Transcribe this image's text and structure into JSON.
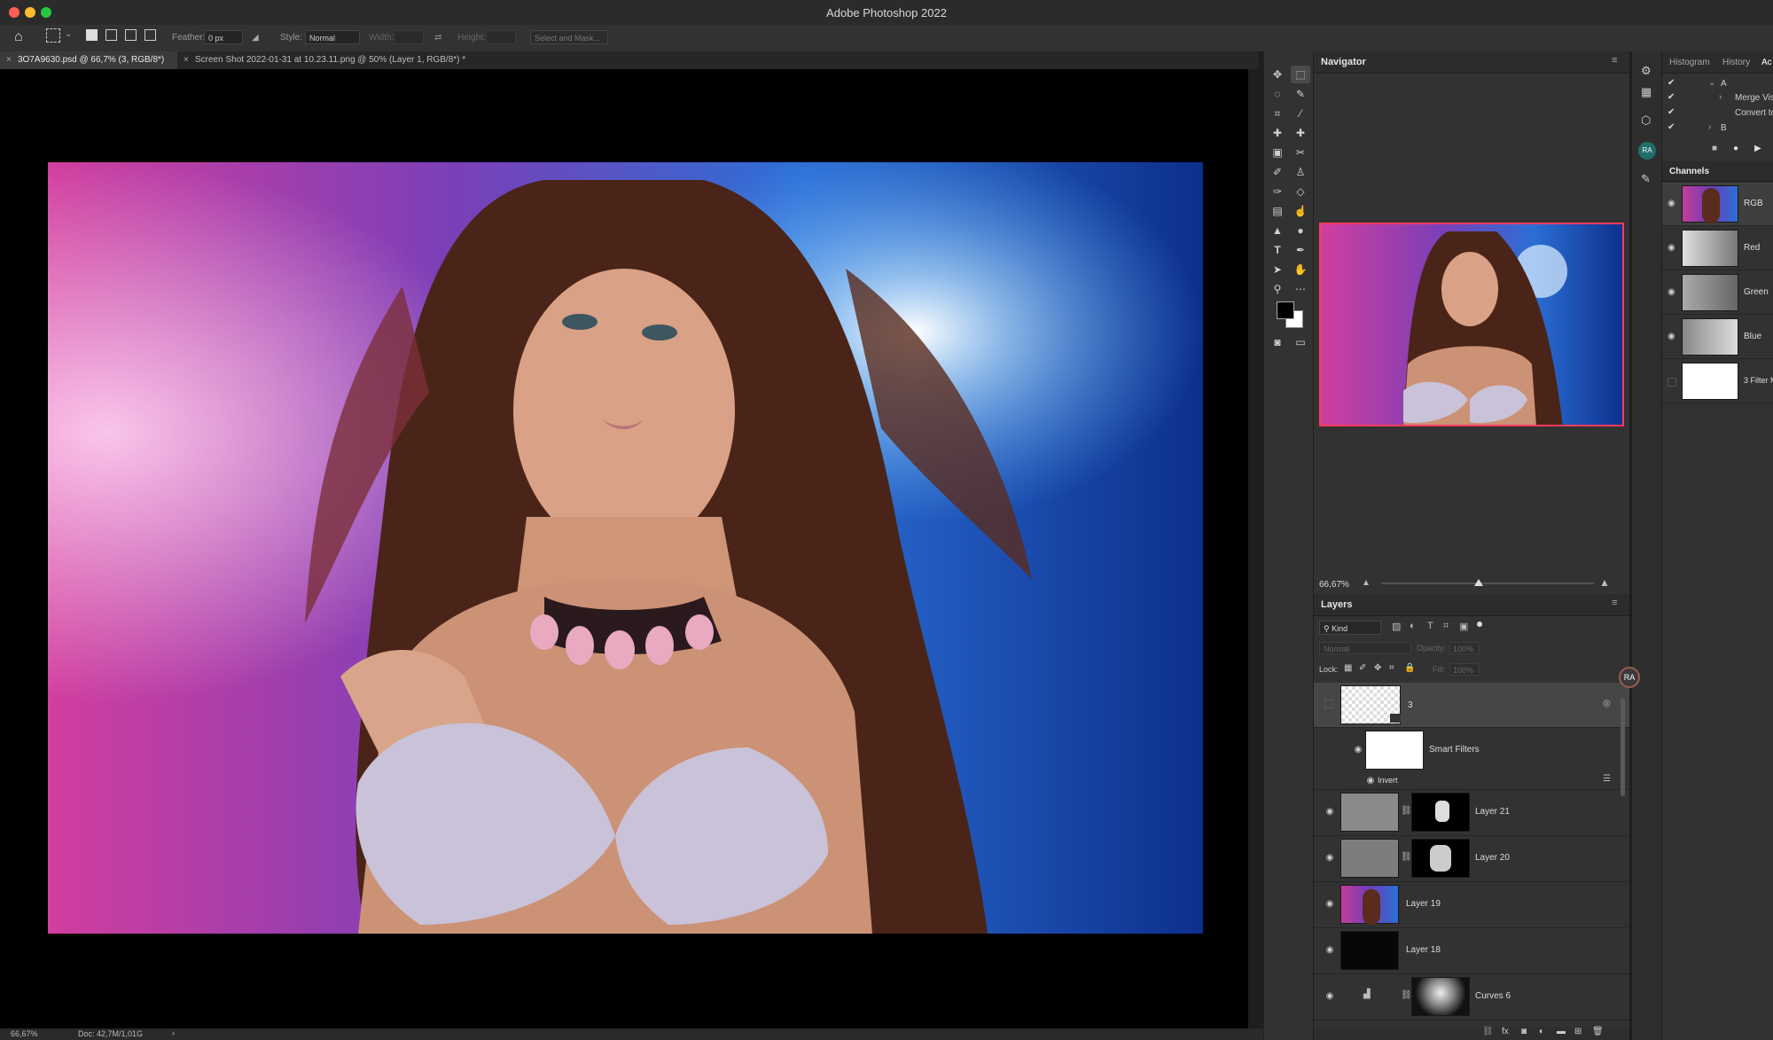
{
  "app": {
    "title": "Adobe Photoshop 2022"
  },
  "options": {
    "feather_label": "Feather:",
    "feather_value": "0 px",
    "style_label": "Style:",
    "style_value": "Normal",
    "width_label": "Width:",
    "height_label": "Height:",
    "select_mask": "Select and Mask..."
  },
  "tabs": [
    {
      "label": "3O7A9630.psd @ 66,7% (3, RGB/8*)"
    },
    {
      "label": "Screen Shot 2022-01-31 at 10.23.11.png @ 50% (Layer 1, RGB/8*) *"
    }
  ],
  "status": {
    "zoom": "66,67%",
    "doc": "Doc: 42,7M/1,01G"
  },
  "navigator": {
    "title": "Navigator",
    "zoom": "66,67%"
  },
  "layers_panel": {
    "title": "Layers",
    "filter": "Kind",
    "blend": "Normal",
    "opacity_label": "Opacity:",
    "opacity_value": "100%",
    "lock_label": "Lock:",
    "fill_label": "Fill:",
    "fill_value": "100%",
    "layers": [
      {
        "name": "3"
      },
      {
        "name": "Smart Filters"
      },
      {
        "name": "Invert"
      },
      {
        "name": "Layer 21"
      },
      {
        "name": "Layer 20"
      },
      {
        "name": "Layer 19"
      },
      {
        "name": "Layer 18"
      },
      {
        "name": "Curves 6"
      }
    ]
  },
  "right_panel": {
    "tabs": [
      "Histogram",
      "History",
      "Ac"
    ],
    "actions": [
      "A",
      "Merge Visib",
      "Convert to",
      "B"
    ],
    "channels_title": "Channels",
    "channels": [
      "RGB",
      "Red",
      "Green",
      "Blue",
      "3 Filter M"
    ]
  },
  "avatar": {
    "initials": "RA"
  },
  "colors": {
    "accent_selection": "#ff3b5c",
    "panel_bg": "#323232"
  }
}
